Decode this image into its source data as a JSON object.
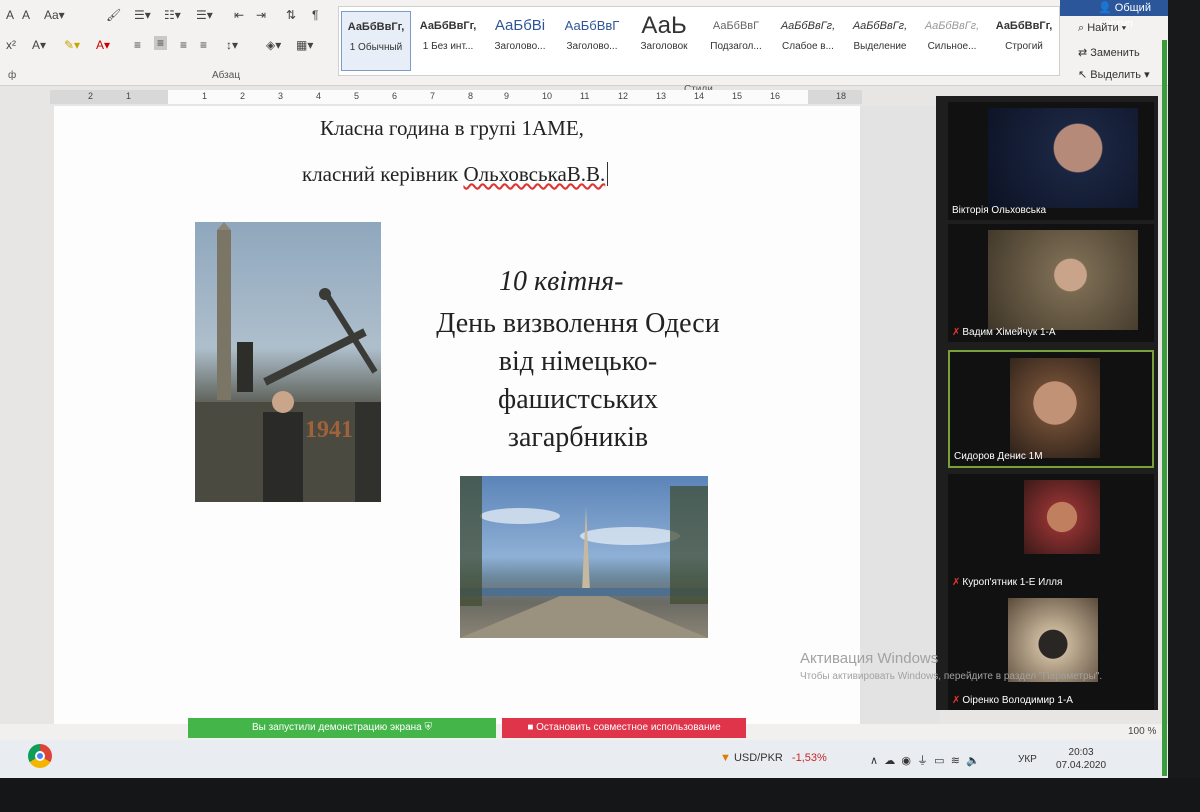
{
  "ribbon": {
    "share_label": "Общий доступ",
    "group_paragraph": "Абзац",
    "group_styles": "Стили",
    "styles": [
      {
        "sample": "АаБбВвГг,",
        "name": "1 Обычный"
      },
      {
        "sample": "АаБбВвГг,",
        "name": "1 Без инт..."
      },
      {
        "sample": "АаБбВі",
        "name": "Заголово..."
      },
      {
        "sample": "АаБбВвГ",
        "name": "Заголово..."
      },
      {
        "sample": "АаЬ",
        "name": "Заголовок"
      },
      {
        "sample": "АаБбВвГ",
        "name": "Подзагол..."
      },
      {
        "sample": "АаБбВвГг,",
        "name": "Слабое в..."
      },
      {
        "sample": "АаБбВвГг,",
        "name": "Выделение"
      },
      {
        "sample": "АаБбВвГг,",
        "name": "Сильное..."
      },
      {
        "sample": "АаБбВвГг,",
        "name": "Строгий"
      }
    ],
    "find_label": "Найти",
    "replace_label": "Заменить",
    "select_label": "Выделить"
  },
  "ruler_numbers": [
    "2",
    "1",
    "1",
    "2",
    "3",
    "4",
    "5",
    "6",
    "7",
    "8",
    "9",
    "10",
    "11",
    "12",
    "13",
    "14",
    "15",
    "16",
    "18"
  ],
  "document": {
    "title_line1": "Класна  година  в групі 1АМЕ,",
    "title_line2_prefix": "класний керівник ",
    "title_line2_name": "ОльховськаВ.В.",
    "date": "10 квітня-",
    "heading_lines": [
      "День визволення Одеси",
      "від німецько-",
      "фашистських",
      "загарбників"
    ]
  },
  "participants": [
    {
      "name": "Вікторія Ольховська",
      "muted": false
    },
    {
      "name": "Вадим Хімейчук 1-А",
      "muted": true
    },
    {
      "name": "Сидоров Денис 1М",
      "muted": false
    },
    {
      "name": "Куроп'ятник 1-Е Илля",
      "muted": true
    },
    {
      "name": "Оіренко Володимир 1-А",
      "muted": true
    }
  ],
  "watermark": {
    "title": "Активация Windows",
    "subtitle": "Чтобы активировать Windows, перейдите в раздел \"Параметры\"."
  },
  "share_bar": {
    "sharing_label": "Вы запустили демонстрацию экрана",
    "stop_label": "Остановить совместное использование"
  },
  "statusbar": {
    "zoom": "100 %"
  },
  "taskbar": {
    "ticker_name": "USD/PKR",
    "ticker_change": "-1,53%",
    "language": "УКР",
    "time": "20:03",
    "date": "07.04.2020"
  }
}
